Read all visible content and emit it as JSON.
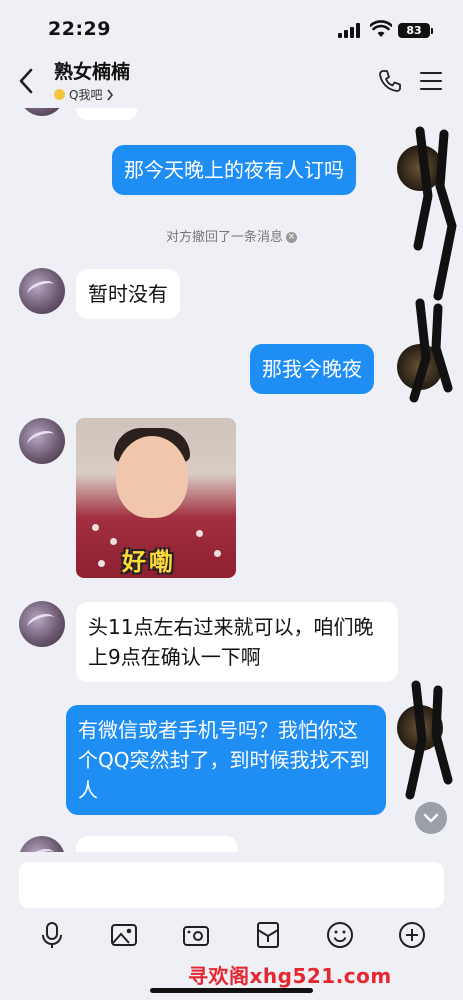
{
  "status_bar": {
    "time": "22:29",
    "battery": "83"
  },
  "header": {
    "title": "熟女楠楠",
    "subtitle": "Q我吧"
  },
  "messages": {
    "m1": "那今天晚上的夜有人订吗",
    "system_recall": "对方撤回了一条消息",
    "m2": "暂时没有",
    "m3": "那我今晚夜",
    "sticker_text": "好嘞",
    "m4": "头11点左右过来就可以，咱们晚上9点在确认一下啊",
    "m5": "有微信或者手机号吗？我怕你这个QQ突然封了，到时候我找不到人"
  },
  "input": {
    "placeholder": ""
  },
  "toolbar": {
    "icons": [
      "microphone-icon",
      "image-icon",
      "camera-icon",
      "red-packet-icon",
      "emoji-icon",
      "plus-icon"
    ]
  },
  "watermark": "寻欢阁xhg521.com",
  "colors": {
    "outgoing_bubble": "#1e8ef5",
    "incoming_bubble": "#ffffff",
    "background": "#eef0f5",
    "watermark": "#e8262f"
  }
}
